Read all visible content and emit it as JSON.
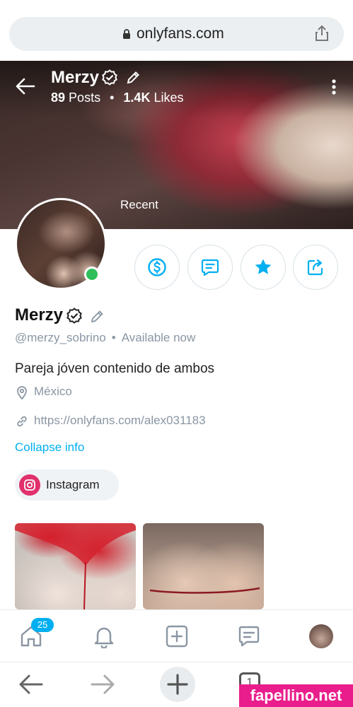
{
  "browser": {
    "url": "onlyfans.com",
    "open_tabs": "1"
  },
  "cover": {
    "name": "Merzy",
    "posts_count": "89",
    "posts_label": "Posts",
    "likes_count": "1.4K",
    "likes_label": "Likes",
    "separator": "•",
    "recent_label": "Recent"
  },
  "profile": {
    "name": "Merzy",
    "handle": "@merzy_sobrino",
    "separator": "•",
    "status": "Available now",
    "bio": "Pareja jóven contenido de ambos",
    "location": "México",
    "website": "https://onlyfans.com/alex031183",
    "collapse_label": "Collapse info",
    "social_label": "Instagram"
  },
  "nav": {
    "home_badge": "25"
  },
  "watermark": "fapellino.net",
  "colors": {
    "accent": "#00aff0",
    "online": "#2ebf5a",
    "instagram": "#e1306c",
    "muted_text": "#8a96a3"
  },
  "icons": [
    "lock-icon",
    "share-icon",
    "back-arrow-icon",
    "verified-icon",
    "edit-icon",
    "more-vertical-icon",
    "dollar-icon",
    "message-icon",
    "star-icon",
    "share-out-icon",
    "location-icon",
    "link-icon",
    "instagram-icon",
    "home-icon",
    "bell-icon",
    "add-post-icon",
    "chat-icon",
    "profile-avatar-icon",
    "browser-back-icon",
    "browser-forward-icon",
    "new-tab-icon",
    "tabs-icon"
  ]
}
